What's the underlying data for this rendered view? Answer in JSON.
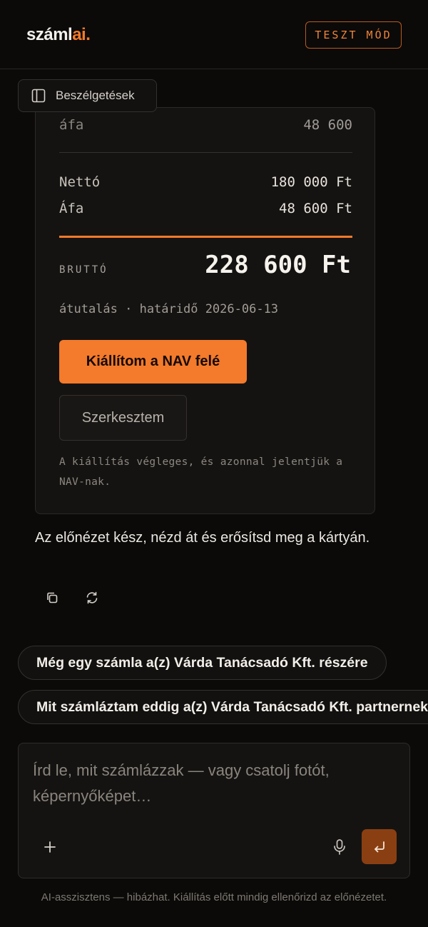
{
  "header": {
    "logo_main": "száml",
    "logo_accent": "ai.",
    "test_badge": "TESZT MÓD"
  },
  "sidebar_toggle": {
    "label": "Beszélgetések",
    "icon": "sidebar-panel-icon"
  },
  "invoice_card": {
    "partial_row": {
      "label": "áfa",
      "value": "48 600"
    },
    "netto": {
      "label": "Nettó",
      "value": "180 000 Ft"
    },
    "afa": {
      "label": "Áfa",
      "value": "48 600 Ft"
    },
    "brutto": {
      "label": "BRUTTÓ",
      "value": "228 600 Ft"
    },
    "payment_info": "átutalás · határidő 2026-06-13",
    "issue_button": "Kiállítom a NAV felé",
    "edit_button": "Szerkesztem",
    "note": "A kiállítás végleges, és azonnal jelentjük a NAV-nak."
  },
  "assistant_message": "Az előnézet kész, nézd át és erősítsd meg a kártyán.",
  "message_actions": [
    "copy-icon",
    "regenerate-icon"
  ],
  "suggestions": [
    "Még egy számla a(z) Várda Tanácsadó Kft. részére",
    "Mit számláztam eddig a(z) Várda Tanácsadó Kft. partnernek?"
  ],
  "composer": {
    "placeholder": "Írd le, mit számlázzak — vagy csatolj fotót, képernyőképet…",
    "icons": [
      "plus-icon",
      "microphone-icon",
      "send-icon"
    ]
  },
  "disclaimer": "AI-asszisztens — hibázhat. Kiállítás előtt mindig ellenőrizd az előnézetet.",
  "colors": {
    "accent": "#f47a2c",
    "background": "#0b0a09",
    "card": "#141312",
    "send_button": "#8a3f12"
  }
}
